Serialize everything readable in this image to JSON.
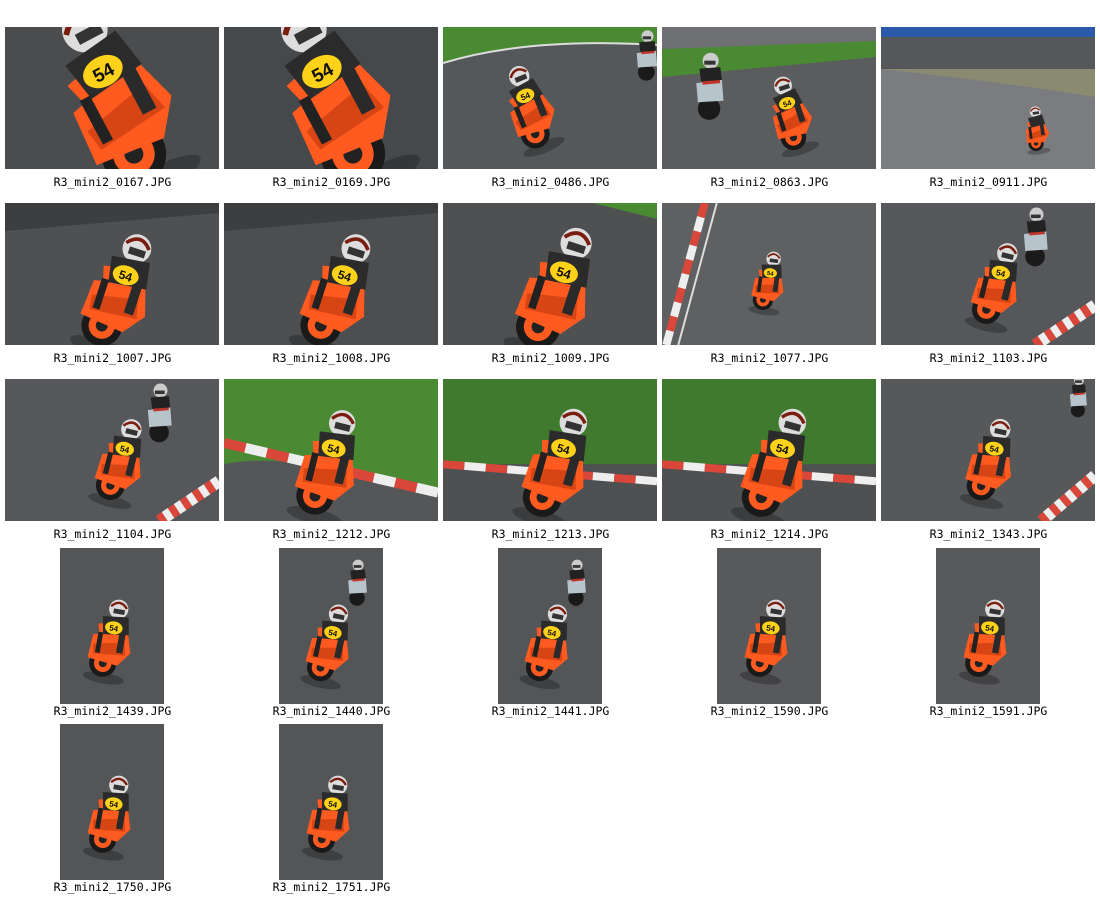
{
  "photos": [
    {
      "filename": "R3_mini2_0167.JPG",
      "orientation": "landscape",
      "scene": "tight-lean-left",
      "bg": "#4a4c4e"
    },
    {
      "filename": "R3_mini2_0169.JPG",
      "orientation": "landscape",
      "scene": "tight-lean-left",
      "bg": "#46494b"
    },
    {
      "filename": "R3_mini2_0486.JPG",
      "orientation": "landscape",
      "scene": "track-curve-grass",
      "bg": "#55585a"
    },
    {
      "filename": "R3_mini2_0863.JPG",
      "orientation": "landscape",
      "scene": "two-riders-grass",
      "bg": "#5a5c5e"
    },
    {
      "filename": "R3_mini2_0911.JPG",
      "orientation": "landscape",
      "scene": "far-rider-wet",
      "bg": "#7a7c80"
    },
    {
      "filename": "R3_mini2_1007.JPG",
      "orientation": "landscape",
      "scene": "lean-right",
      "bg": "#4e5052"
    },
    {
      "filename": "R3_mini2_1008.JPG",
      "orientation": "landscape",
      "scene": "lean-right",
      "bg": "#4c4e50"
    },
    {
      "filename": "R3_mini2_1009.JPG",
      "orientation": "landscape",
      "scene": "lean-right-close",
      "bg": "#4e5052"
    },
    {
      "filename": "R3_mini2_1077.JPG",
      "orientation": "landscape",
      "scene": "small-rider-kerb-left",
      "bg": "#5e6062"
    },
    {
      "filename": "R3_mini2_1103.JPG",
      "orientation": "landscape",
      "scene": "two-riders-kerb-right",
      "bg": "#55575a"
    },
    {
      "filename": "R3_mini2_1104.JPG",
      "orientation": "landscape",
      "scene": "two-riders-kerb-right",
      "bg": "#55575a"
    },
    {
      "filename": "R3_mini2_1212.JPG",
      "orientation": "landscape",
      "scene": "kerb-grass-lean",
      "bg": "#545658"
    },
    {
      "filename": "R3_mini2_1213.JPG",
      "orientation": "landscape",
      "scene": "grass-lean",
      "bg": "#3f7a2e"
    },
    {
      "filename": "R3_mini2_1214.JPG",
      "orientation": "landscape",
      "scene": "grass-lean",
      "bg": "#3f7a2e"
    },
    {
      "filename": "R3_mini2_1343.JPG",
      "orientation": "landscape",
      "scene": "rider-kerb-right",
      "bg": "#56585a"
    },
    {
      "filename": "R3_mini2_1439.JPG",
      "orientation": "portrait",
      "scene": "portrait-rider",
      "bg": "#535557"
    },
    {
      "filename": "R3_mini2_1440.JPG",
      "orientation": "portrait",
      "scene": "portrait-two",
      "bg": "#535557"
    },
    {
      "filename": "R3_mini2_1441.JPG",
      "orientation": "portrait",
      "scene": "portrait-two",
      "bg": "#535557"
    },
    {
      "filename": "R3_mini2_1590.JPG",
      "orientation": "portrait",
      "scene": "portrait-rider",
      "bg": "#58595b"
    },
    {
      "filename": "R3_mini2_1591.JPG",
      "orientation": "portrait",
      "scene": "portrait-rider",
      "bg": "#58595b"
    },
    {
      "filename": "R3_mini2_1750.JPG",
      "orientation": "portrait",
      "scene": "portrait-rider",
      "bg": "#535557"
    },
    {
      "filename": "R3_mini2_1751.JPG",
      "orientation": "portrait",
      "scene": "portrait-rider",
      "bg": "#535557"
    }
  ],
  "colors": {
    "bike": "#ff5a1f",
    "bike_dark": "#c73c10",
    "number_plate": "#ffd21a",
    "grass": "#4a8a32",
    "kerb_red": "#d9473a",
    "kerb_white": "#eeeeee"
  },
  "rider_number": "54"
}
